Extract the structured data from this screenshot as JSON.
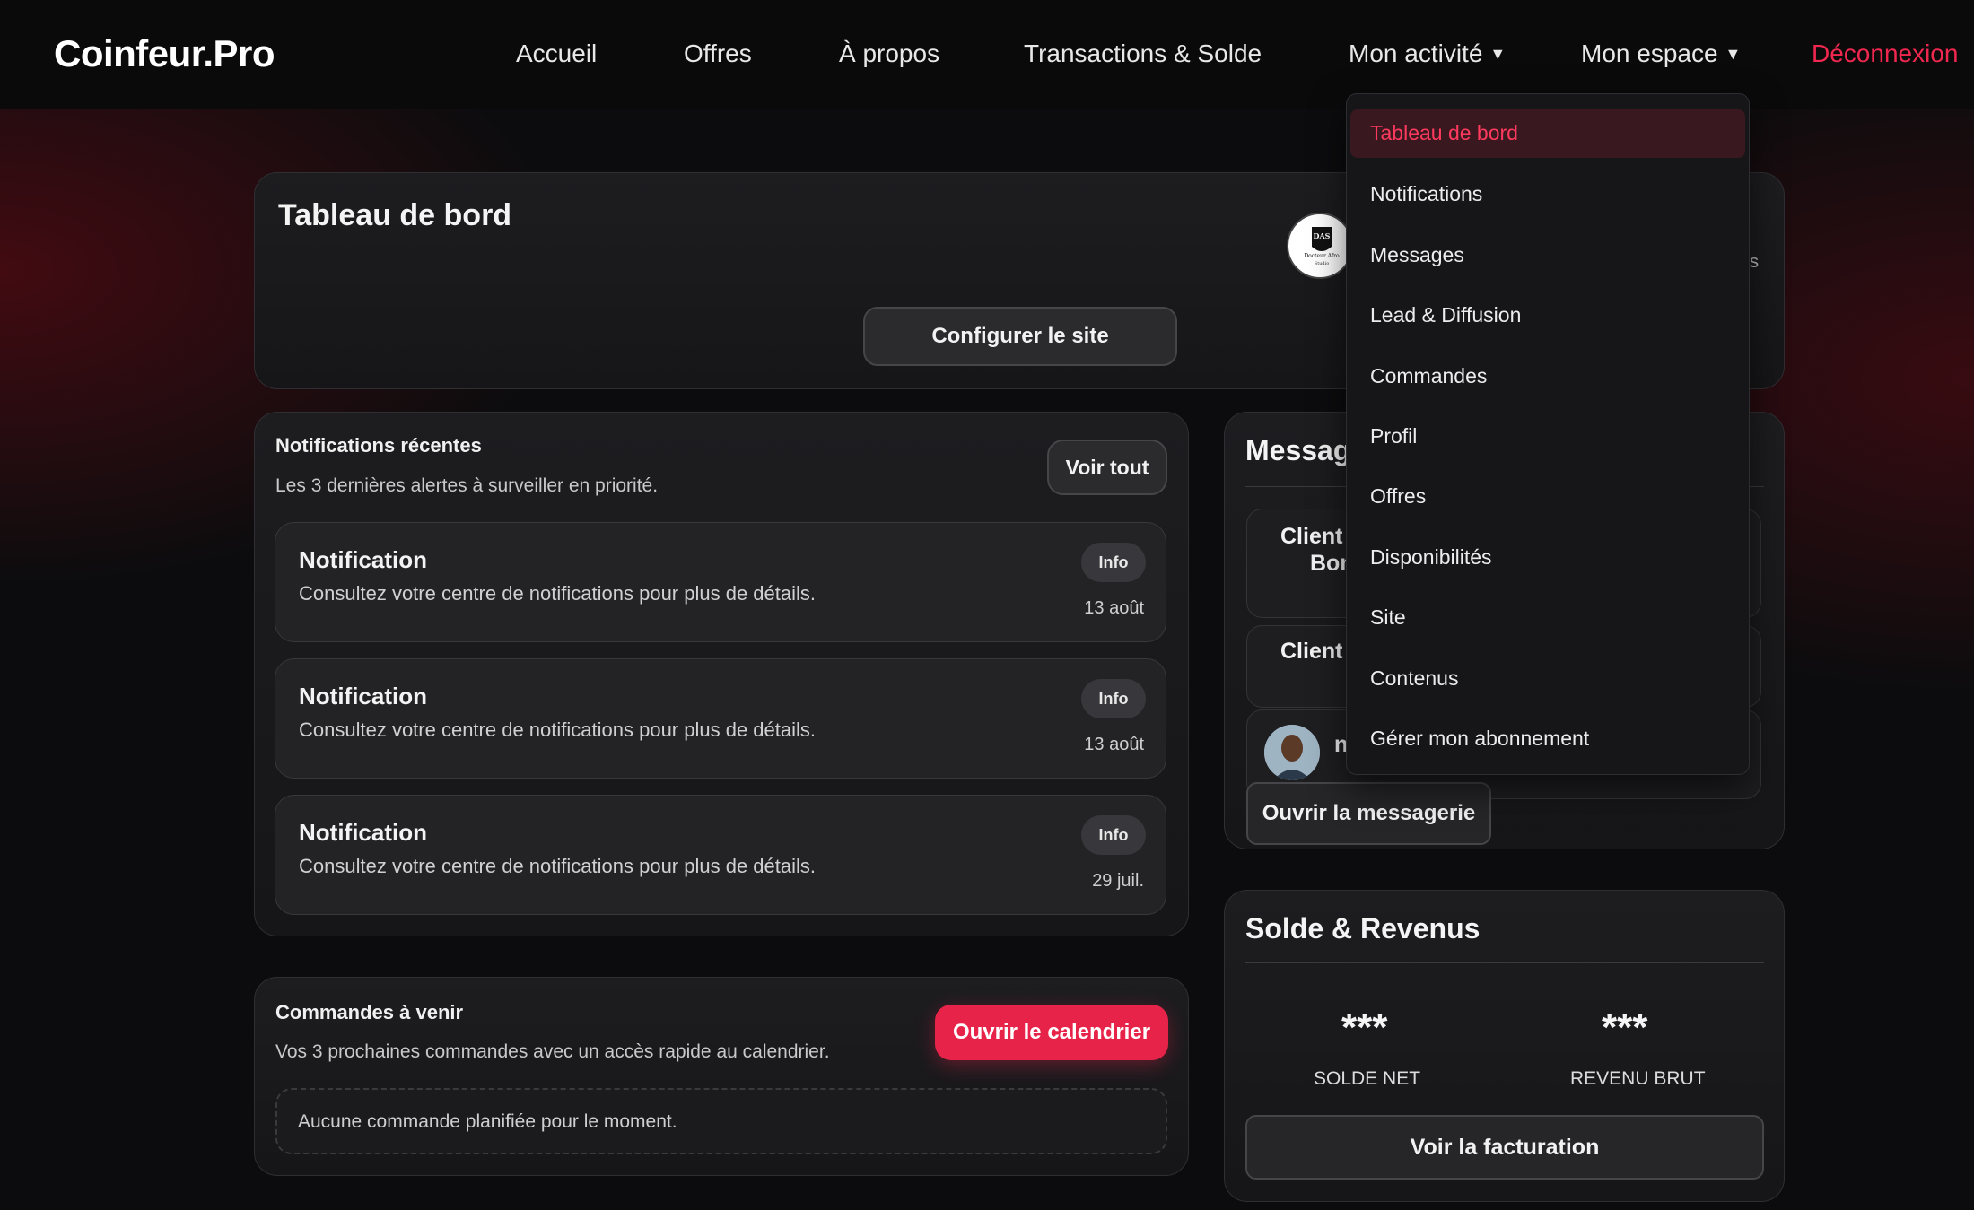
{
  "brand": {
    "logo": "Coinfeur.Pro",
    "accent": "#e8234a"
  },
  "nav": {
    "items": [
      {
        "label": "Accueil"
      },
      {
        "label": "Offres"
      },
      {
        "label": "À propos"
      },
      {
        "label": "Transactions & Solde"
      },
      {
        "label": "Mon activité",
        "caret": "▼"
      },
      {
        "label": "Mon espace",
        "caret": "▼"
      }
    ],
    "logout": "Déconnexion"
  },
  "dashboard": {
    "title": "Tableau de bord",
    "configure_button": "Configurer le site",
    "hidden_partial_text": "s",
    "logo_lines": [
      "DAS",
      "Docteur Afro",
      "Studio"
    ]
  },
  "notifications": {
    "title": "Notifications récentes",
    "subtitle": "Les 3 dernières alertes à surveiller en priorité.",
    "see_all": "Voir tout",
    "items": [
      {
        "title": "Notification",
        "text": "Consultez votre centre de notifications pour plus de détails.",
        "badge": "Info",
        "date": "13 août"
      },
      {
        "title": "Notification",
        "text": "Consultez votre centre de notifications pour plus de détails.",
        "badge": "Info",
        "date": "13 août"
      },
      {
        "title": "Notification",
        "text": "Consultez votre centre de notifications pour plus de détails.",
        "badge": "Info",
        "date": "29 juil."
      }
    ]
  },
  "orders": {
    "title": "Commandes à venir",
    "subtitle": "Vos 3 prochaines commandes avec un accès rapide au calendrier.",
    "calendar_button": "Ouvrir le calendrier",
    "empty": "Aucune commande planifiée pour le moment."
  },
  "messages": {
    "title": "Messag",
    "rows": [
      {
        "name_line1": "Client",
        "name_line2": "Bon"
      },
      {
        "name_line1": "Client"
      },
      {
        "name_line1": "n"
      }
    ],
    "open_button": "Ouvrir la messagerie"
  },
  "balance": {
    "title": "Solde & Revenus",
    "net_value": "***",
    "net_label": "SOLDE NET",
    "gross_value": "***",
    "gross_label": "REVENU BRUT",
    "billing_button": "Voir la facturation"
  },
  "dropdown": {
    "items": [
      {
        "label": "Tableau de bord",
        "active": true
      },
      {
        "label": "Notifications"
      },
      {
        "label": "Messages"
      },
      {
        "label": "Lead & Diffusion"
      },
      {
        "label": "Commandes"
      },
      {
        "label": "Profil"
      },
      {
        "label": "Offres"
      },
      {
        "label": "Disponibilités"
      },
      {
        "label": "Site"
      },
      {
        "label": "Contenus"
      },
      {
        "label": "Gérer mon abonnement"
      }
    ]
  }
}
